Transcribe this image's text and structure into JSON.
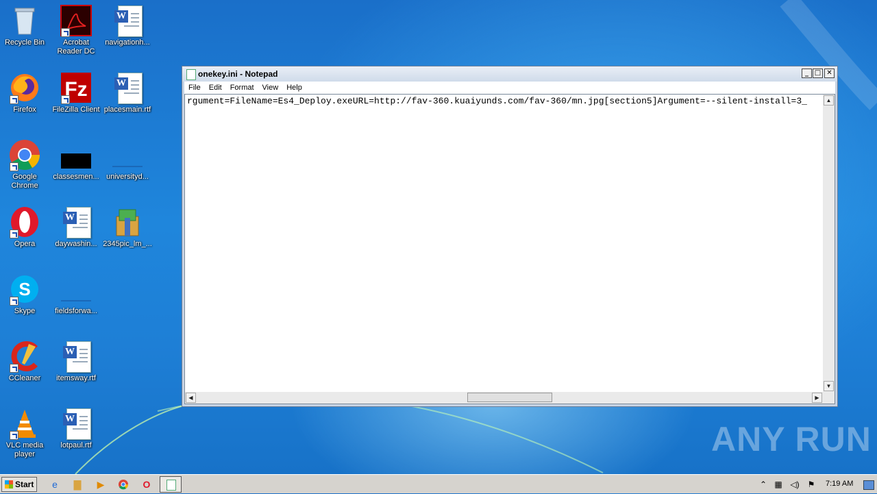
{
  "desktop_icons": [
    {
      "label": "Recycle Bin",
      "icon": "recycle-bin-icon"
    },
    {
      "label": "Acrobat Reader DC",
      "icon": "acrobat-icon"
    },
    {
      "label": "navigationh...",
      "icon": "word-doc-icon"
    },
    {
      "label": "Firefox",
      "icon": "firefox-icon"
    },
    {
      "label": "FileZilla Client",
      "icon": "filezilla-icon"
    },
    {
      "label": "placesmain.rtf",
      "icon": "word-doc-icon"
    },
    {
      "label": "Google Chrome",
      "icon": "chrome-icon"
    },
    {
      "label": "classesmen...",
      "icon": "black-file-icon"
    },
    {
      "label": "universityd...",
      "icon": "blank-file-icon"
    },
    {
      "label": "Opera",
      "icon": "opera-icon"
    },
    {
      "label": "daywashin...",
      "icon": "word-doc-icon"
    },
    {
      "label": "2345pic_lm_...",
      "icon": "installer-icon"
    },
    {
      "label": "Skype",
      "icon": "skype-icon"
    },
    {
      "label": "fieldsforwa...",
      "icon": "blank-file-icon"
    },
    {
      "label": "CCleaner",
      "icon": "ccleaner-icon"
    },
    {
      "label": "itemsway.rtf",
      "icon": "word-doc-icon"
    },
    {
      "label": "VLC media player",
      "icon": "vlc-icon"
    },
    {
      "label": "lotpaul.rtf",
      "icon": "word-doc-icon"
    }
  ],
  "notepad": {
    "title": "onekey.ini - Notepad",
    "menu": [
      "File",
      "Edit",
      "Format",
      "View",
      "Help"
    ],
    "content": "rgument=FileName=Es4_Deploy.exeURL=http://fav-360.kuaiyunds.com/fav-360/mn.jpg[section5]Argument=--silent-install=3_"
  },
  "watermark": "ANY RUN",
  "taskbar": {
    "start_label": "Start",
    "clock": "7:19 AM"
  },
  "colors": {
    "desktop_blue": "#1e7fd6",
    "taskbar_gray": "#d6d3ce"
  }
}
